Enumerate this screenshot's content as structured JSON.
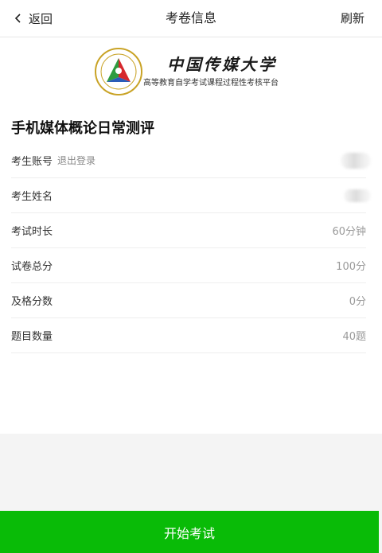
{
  "header": {
    "back_label": "返回",
    "title": "考卷信息",
    "refresh_label": "刷新"
  },
  "logo": {
    "school_name": "中国传媒大学",
    "subtitle": "高等教育自学考试课程过程性考核平台"
  },
  "exam": {
    "title": "手机媒体概论日常测评"
  },
  "rows": [
    {
      "label": "考生账号",
      "action": "退出登录",
      "value": ""
    },
    {
      "label": "考生姓名",
      "value": ""
    },
    {
      "label": "考试时长",
      "value": "60分钟"
    },
    {
      "label": "试卷总分",
      "value": "100分"
    },
    {
      "label": "及格分数",
      "value": "0分"
    },
    {
      "label": "题目数量",
      "value": "40题"
    }
  ],
  "footer": {
    "start_label": "开始考试"
  },
  "colors": {
    "primary_green": "#09bb07",
    "background": "#f4f4f4"
  },
  "icons": {
    "back": "chevron-left-icon"
  }
}
